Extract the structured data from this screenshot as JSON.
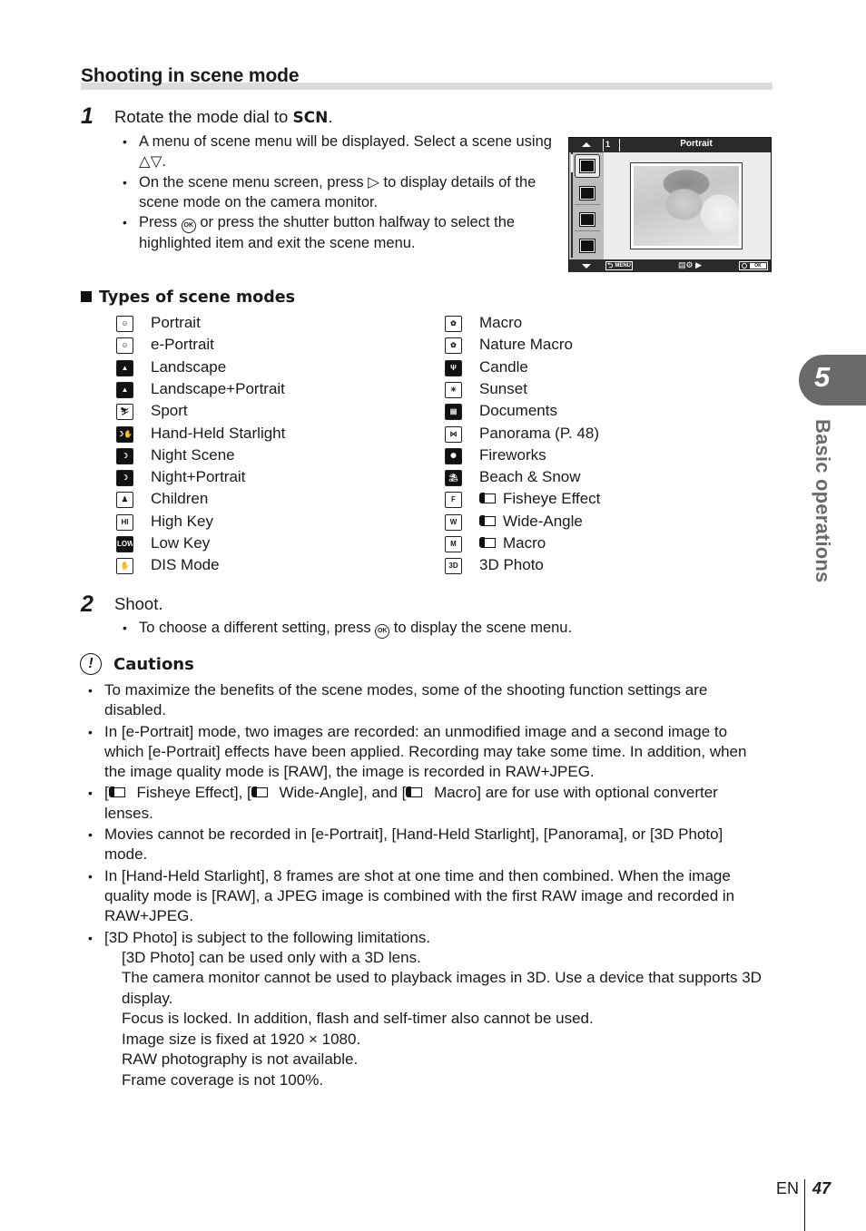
{
  "section_title": "Shooting in scene mode",
  "step1": {
    "number": "1",
    "text_prefix": "Rotate the mode dial to ",
    "text_bold": "SCN",
    "text_suffix": ".",
    "bullets": [
      {
        "pre": "A menu of scene menu will be displayed. Select a scene using ",
        "glyph": "△▽",
        "post": "."
      },
      {
        "pre": "On the scene menu screen, press ",
        "glyph": "▷",
        "post": " to display details of the scene mode on the camera monitor."
      },
      {
        "pre": "Press ",
        "glyph": "OK",
        "post": " or press the shutter button halfway to select the highlighted item and exit the scene menu."
      }
    ]
  },
  "camera_screen": {
    "index": "1",
    "title": "Portrait",
    "menu_label": "MENU",
    "ok_label": "OK",
    "info_glyph": "▤⚙ ▶",
    "side_icons": [
      "portrait-icon",
      "e-portrait-icon",
      "landscape-icon",
      "landscape-portrait-icon"
    ]
  },
  "types_heading": "Types of scene modes",
  "modes_left": [
    {
      "icon": "portrait-icon",
      "glyph": "☺",
      "label": "Portrait"
    },
    {
      "icon": "e-portrait-icon",
      "glyph": "☺",
      "label": "e-Portrait"
    },
    {
      "icon": "landscape-icon",
      "glyph": "▲",
      "label": "Landscape"
    },
    {
      "icon": "landscape-portrait-icon",
      "glyph": "▲",
      "label": "Landscape+Portrait"
    },
    {
      "icon": "sport-icon",
      "glyph": "⛷",
      "label": "Sport"
    },
    {
      "icon": "hand-held-starlight-icon",
      "glyph": "☽✋",
      "label": "Hand-Held Starlight"
    },
    {
      "icon": "night-scene-icon",
      "glyph": "☽",
      "label": "Night Scene"
    },
    {
      "icon": "night-portrait-icon",
      "glyph": "☽",
      "label": "Night+Portrait"
    },
    {
      "icon": "children-icon",
      "glyph": "♟",
      "label": "Children"
    },
    {
      "icon": "high-key-icon",
      "glyph": "HI",
      "label": "High Key"
    },
    {
      "icon": "low-key-icon",
      "glyph": "LOW",
      "label": "Low Key"
    },
    {
      "icon": "dis-mode-icon",
      "glyph": "✋",
      "label": "DIS Mode"
    }
  ],
  "modes_right": [
    {
      "icon": "macro-icon",
      "glyph": "✿",
      "label": "Macro"
    },
    {
      "icon": "nature-macro-icon",
      "glyph": "✿",
      "label": "Nature Macro"
    },
    {
      "icon": "candle-icon",
      "glyph": "Ψ",
      "label": "Candle"
    },
    {
      "icon": "sunset-icon",
      "glyph": "☀",
      "label": "Sunset"
    },
    {
      "icon": "documents-icon",
      "glyph": "▤",
      "label": "Documents"
    },
    {
      "icon": "panorama-icon",
      "glyph": "⋈",
      "label": "Panorama (P. 48)"
    },
    {
      "icon": "fireworks-icon",
      "glyph": "✺",
      "label": "Fireworks"
    },
    {
      "icon": "beach-snow-icon",
      "glyph": "⛱",
      "label": "Beach & Snow"
    },
    {
      "icon": "fisheye-effect-icon",
      "glyph": "F",
      "label": "Fisheye Effect",
      "lens": true
    },
    {
      "icon": "wide-angle-icon",
      "glyph": "W",
      "label": "Wide-Angle",
      "lens": true
    },
    {
      "icon": "converter-macro-icon",
      "glyph": "M",
      "label": "Macro",
      "lens": true
    },
    {
      "icon": "3d-photo-icon",
      "glyph": "3D",
      "label": "3D Photo"
    }
  ],
  "step2": {
    "number": "2",
    "text": "Shoot.",
    "bullet_pre": "To choose a different setting, press ",
    "bullet_glyph": "OK",
    "bullet_post": " to display the scene menu."
  },
  "cautions": {
    "icon_glyph": "!",
    "heading": "Cautions",
    "items": [
      "To maximize the benefits of the scene modes, some of the shooting function settings are disabled.",
      "In [e-Portrait] mode, two images are recorded: an unmodified image and a second image to which [e-Portrait] effects have been applied. Recording may take some time. In addition, when the image quality mode is [RAW], the image is recorded in RAW+JPEG.",
      "Movies cannot be recorded in [e-Portrait], [Hand-Held Starlight], [Panorama], or [3D Photo] mode.",
      "In [Hand-Held Starlight], 8 frames are shot at one time and then combined. When the image quality mode is [RAW], a JPEG image is combined with the first RAW image and recorded in RAW+JPEG.",
      "[3D Photo] is subject to the following limitations."
    ],
    "converter_item": {
      "parts": [
        "[",
        " Fisheye Effect], [",
        " Wide-Angle], and [",
        " Macro] are for use with optional converter lenses."
      ]
    },
    "limitations": [
      "[3D Photo] can be used only with a 3D lens.",
      "The camera monitor cannot be used to playback images in 3D. Use a device that supports 3D display.",
      "Focus is locked. In addition, flash and self-timer also cannot be used.",
      "Image size is fixed at 1920 × 1080.",
      "RAW photography is not available.",
      "Frame coverage is not 100%."
    ]
  },
  "chapter_tab": {
    "number": "5",
    "label": "Basic operations"
  },
  "footer": {
    "lang": "EN",
    "page": "47"
  }
}
